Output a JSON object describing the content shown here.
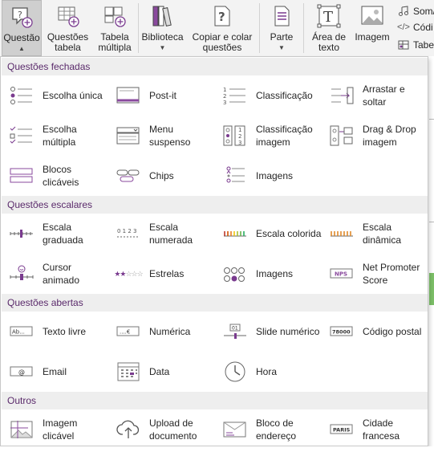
{
  "ribbon": {
    "question": {
      "label": "Questão"
    },
    "question_table": {
      "label": "Questões tabela"
    },
    "multi_table": {
      "label": "Tabela múltipla"
    },
    "library": {
      "label": "Biblioteca"
    },
    "copy_paste": {
      "label": "Copiar e colar questões"
    },
    "part": {
      "label": "Parte"
    },
    "text_area": {
      "label": "Área de texto"
    },
    "image": {
      "label": "Imagem"
    },
    "sound": {
      "label": "Som/"
    },
    "code": {
      "label": "Códi"
    },
    "table": {
      "label": "Tabel"
    }
  },
  "sections": [
    {
      "title": "Questões fechadas"
    },
    {
      "title": "Questões escalares"
    },
    {
      "title": "Questões abertas"
    },
    {
      "title": "Outros"
    }
  ],
  "items": {
    "closed": [
      "Escolha única",
      "Post-it",
      "Classificação",
      "Arrastar e soltar",
      "Escolha múltipla",
      "Menu suspenso",
      "Classificação imagem",
      "Drag & Drop imagem",
      "Blocos clicáveis",
      "Chips",
      "Imagens"
    ],
    "scale": [
      "Escala graduada",
      "Escala numerada",
      "Escala colorida",
      "Escala dinâmica",
      "Cursor animado",
      "Estrelas",
      "Imagens",
      "Net Promoter Score"
    ],
    "open": [
      "Texto livre",
      "Numérica",
      "Slide numérico",
      "Código postal",
      "Email",
      "Data",
      "Hora"
    ],
    "other": [
      "Imagem clicável",
      "Upload de documento",
      "Bloco de endereço",
      "Cidade francesa"
    ]
  },
  "icon_text": {
    "free_text": "Ab...",
    "numeric": "....€",
    "slider": "01",
    "postal": "78000",
    "email": "@",
    "nps": "NPS",
    "city": "PARIS",
    "scale_numbers": "0 1 2 3"
  },
  "colors": {
    "section_text": "#5a2a6b",
    "accent": "#7a3b8f",
    "active_button": "#cfcfcf"
  }
}
